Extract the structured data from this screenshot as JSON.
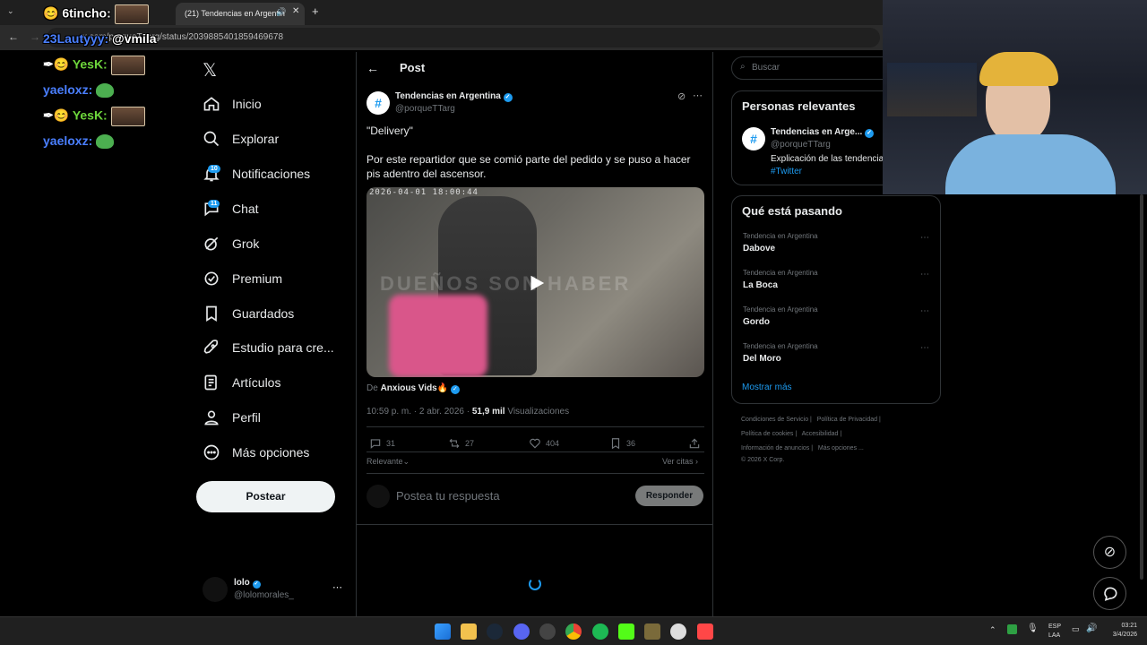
{
  "browser": {
    "tab_title": "(21) Tendencias en Argentin",
    "url": "x.com/porqueTTarg/status/2039885401859469678"
  },
  "chat_overlay": [
    {
      "user": "6tincho:",
      "kind": "face"
    },
    {
      "user": "23Lautyyy:",
      "msg": "@vmila"
    },
    {
      "user": "YesK:",
      "kind": "face"
    },
    {
      "user": "yaeloxz:",
      "kind": "frog"
    },
    {
      "user": "YesK:",
      "kind": "face"
    },
    {
      "user": "yaeloxz:",
      "kind": "frog"
    }
  ],
  "nav": {
    "items": [
      {
        "label": "Inicio",
        "icon": "home-icon"
      },
      {
        "label": "Explorar",
        "icon": "search-icon"
      },
      {
        "label": "Notificaciones",
        "icon": "bell-icon",
        "badge": "10"
      },
      {
        "label": "Chat",
        "icon": "chat-icon",
        "badge": "11"
      },
      {
        "label": "Grok",
        "icon": "grok-icon"
      },
      {
        "label": "Premium",
        "icon": "premium-icon"
      },
      {
        "label": "Guardados",
        "icon": "bookmark-icon"
      },
      {
        "label": "Estudio para cre...",
        "icon": "rocket-icon"
      },
      {
        "label": "Artículos",
        "icon": "article-icon"
      },
      {
        "label": "Perfil",
        "icon": "person-icon"
      },
      {
        "label": "Más opciones",
        "icon": "more-icon"
      }
    ],
    "post_button": "Postear",
    "account_name": "lolo",
    "account_handle": "@lolomorales_"
  },
  "post": {
    "header": "Post",
    "author_name": "Tendencias en Argentina",
    "author_handle": "@porqueTTarg",
    "text_line1": "\"Delivery\"",
    "text_line2": "Por este repartidor que se comió parte del pedido y se puso a hacer pis adentro del ascensor.",
    "video_timestamp": "2026-04-01 18:00:44",
    "video_watermark": "DUEÑOS SON HABER",
    "from_label": "De",
    "from_name": "Anxious Vids🔥",
    "time": "10:59 p. m. · 2 abr. 2026 ·",
    "views_count": "51,9 mil",
    "views_label": "Visualizaciones",
    "replies": "31",
    "reposts": "27",
    "likes": "404",
    "bookmarks": "36",
    "sort_label": "Relevante",
    "quotes_label": "Ver citas",
    "reply_placeholder": "Postea tu respuesta",
    "reply_button": "Responder"
  },
  "sidebar": {
    "search_placeholder": "Buscar",
    "relevant_title": "Personas relevantes",
    "relevant_name": "Tendencias en Arge...",
    "relevant_handle": "@porqueTTarg",
    "relevant_bio": "Explicación de las tendencia",
    "relevant_hashtag": "#Twitter",
    "trending_title": "Qué está pasando",
    "trends": [
      {
        "context": "Tendencia en Argentina",
        "name": "Dabove"
      },
      {
        "context": "Tendencia en Argentina",
        "name": "La Boca"
      },
      {
        "context": "Tendencia en Argentina",
        "name": "Gordo"
      },
      {
        "context": "Tendencia en Argentina",
        "name": "Del Moro"
      }
    ],
    "show_more": "Mostrar más",
    "footer_line1": [
      "Condiciones de Servicio",
      "Política de Privacidad"
    ],
    "footer_line2": [
      "Política de cookies",
      "Accesibilidad"
    ],
    "footer_line3": [
      "Información de anuncios",
      "Más opciones ..."
    ],
    "copyright": "© 2026 X Corp."
  },
  "taskbar": {
    "lang1": "ESP",
    "lang2": "LAA",
    "time": "03:21",
    "date": "3/4/2026"
  },
  "colors": {
    "accent": "#1d9bf0",
    "background": "#000000",
    "border": "#2f3336"
  }
}
